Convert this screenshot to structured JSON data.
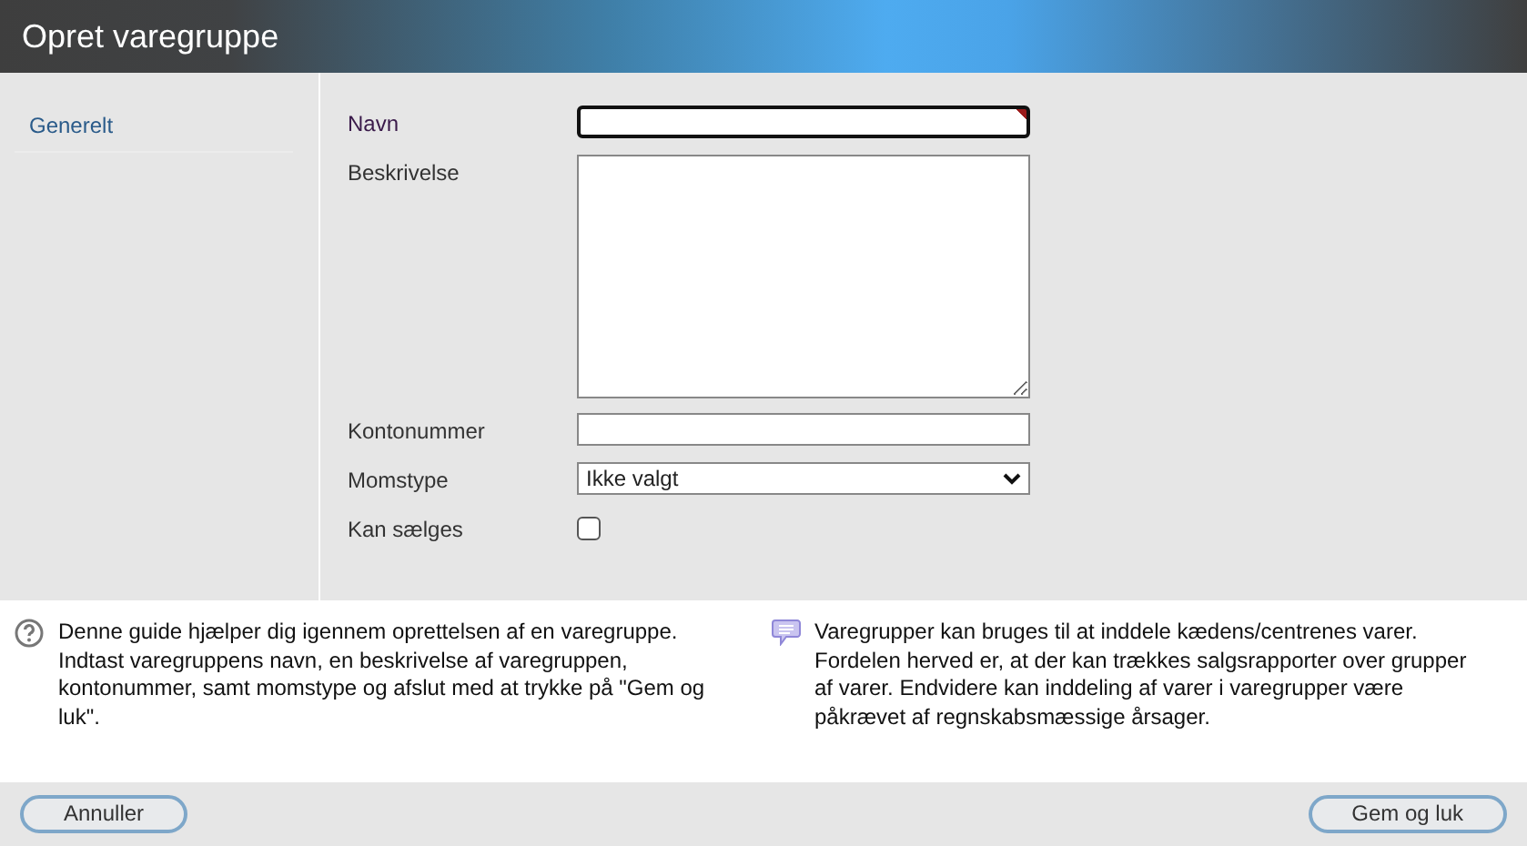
{
  "window": {
    "title": "Opret varegruppe"
  },
  "sidebar": {
    "items": [
      {
        "label": "Generelt",
        "selected": true
      }
    ]
  },
  "form": {
    "fields": [
      {
        "kind": "text",
        "label": "Navn",
        "required": true,
        "focused": true
      },
      {
        "kind": "textarea",
        "label": "Beskrivelse",
        "required": false,
        "focused": false
      },
      {
        "kind": "text",
        "label": "Kontonummer",
        "required": false,
        "focused": false
      },
      {
        "kind": "select",
        "label": "Momstype",
        "value": "Ikke valgt",
        "required": false,
        "focused": false
      },
      {
        "kind": "checkbox",
        "label": "Kan sælges",
        "checked": false,
        "required": false,
        "focused": false
      }
    ]
  },
  "info": [
    {
      "kind": "help",
      "text": "Denne guide hjælper dig igennem oprettelsen af en varegruppe. Indtast varegruppens navn, en beskrivelse af varegruppen, kontonummer, samt momstype og afslut med at trykke på \"Gem og luk\"."
    },
    {
      "kind": "note",
      "text": "Varegrupper kan bruges til at inddele kædens/centrenes varer. Fordelen herved er, at der kan trækkes salgsrapporter over grupper af varer. Endvidere kan inddeling af varer i varegrupper være påkrævet af regnskabsmæssige årsager."
    }
  ],
  "buttons": [
    {
      "label": "Annuller"
    },
    {
      "label": "Gem og luk"
    }
  ]
}
